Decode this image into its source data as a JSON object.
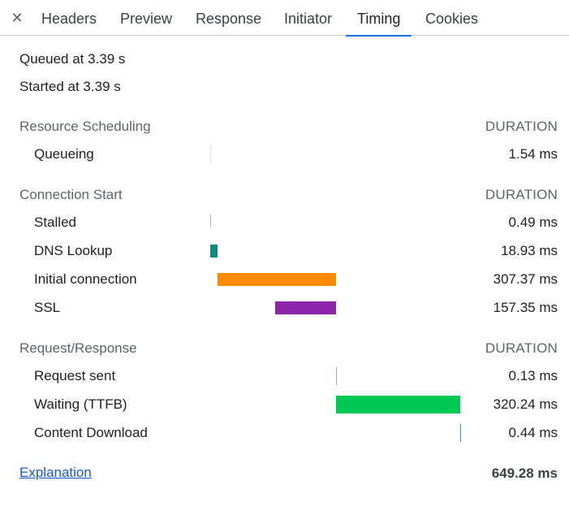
{
  "close_icon": "close-icon",
  "tabs": [
    {
      "label": "Headers"
    },
    {
      "label": "Preview"
    },
    {
      "label": "Response"
    },
    {
      "label": "Initiator"
    },
    {
      "label": "Timing",
      "active": true
    },
    {
      "label": "Cookies"
    }
  ],
  "queued_at": "Queued at 3.39 s",
  "started_at": "Started at 3.39 s",
  "sections": [
    {
      "title": "Resource Scheduling",
      "duration_header": "DURATION",
      "rows": [
        {
          "label": "Queueing",
          "value": "1.54 ms",
          "color": "#dadce0"
        }
      ]
    },
    {
      "title": "Connection Start",
      "duration_header": "DURATION",
      "rows": [
        {
          "label": "Stalled",
          "value": "0.49 ms",
          "color": "#b0b3b8"
        },
        {
          "label": "DNS Lookup",
          "value": "18.93 ms",
          "color": "#0f8a7e"
        },
        {
          "label": "Initial connection",
          "value": "307.37 ms",
          "color": "#fb8c00"
        },
        {
          "label": "SSL",
          "value": "157.35 ms",
          "color": "#8e24aa"
        }
      ]
    },
    {
      "title": "Request/Response",
      "duration_header": "DURATION",
      "rows": [
        {
          "label": "Request sent",
          "value": "0.13 ms",
          "color": "#8fa8c8"
        },
        {
          "label": "Waiting (TTFB)",
          "value": "320.24 ms",
          "color": "#00c853"
        },
        {
          "label": "Content Download",
          "value": "0.44 ms",
          "color": "#26a69a"
        }
      ]
    }
  ],
  "explanation_link": "Explanation",
  "total": "649.28 ms"
}
